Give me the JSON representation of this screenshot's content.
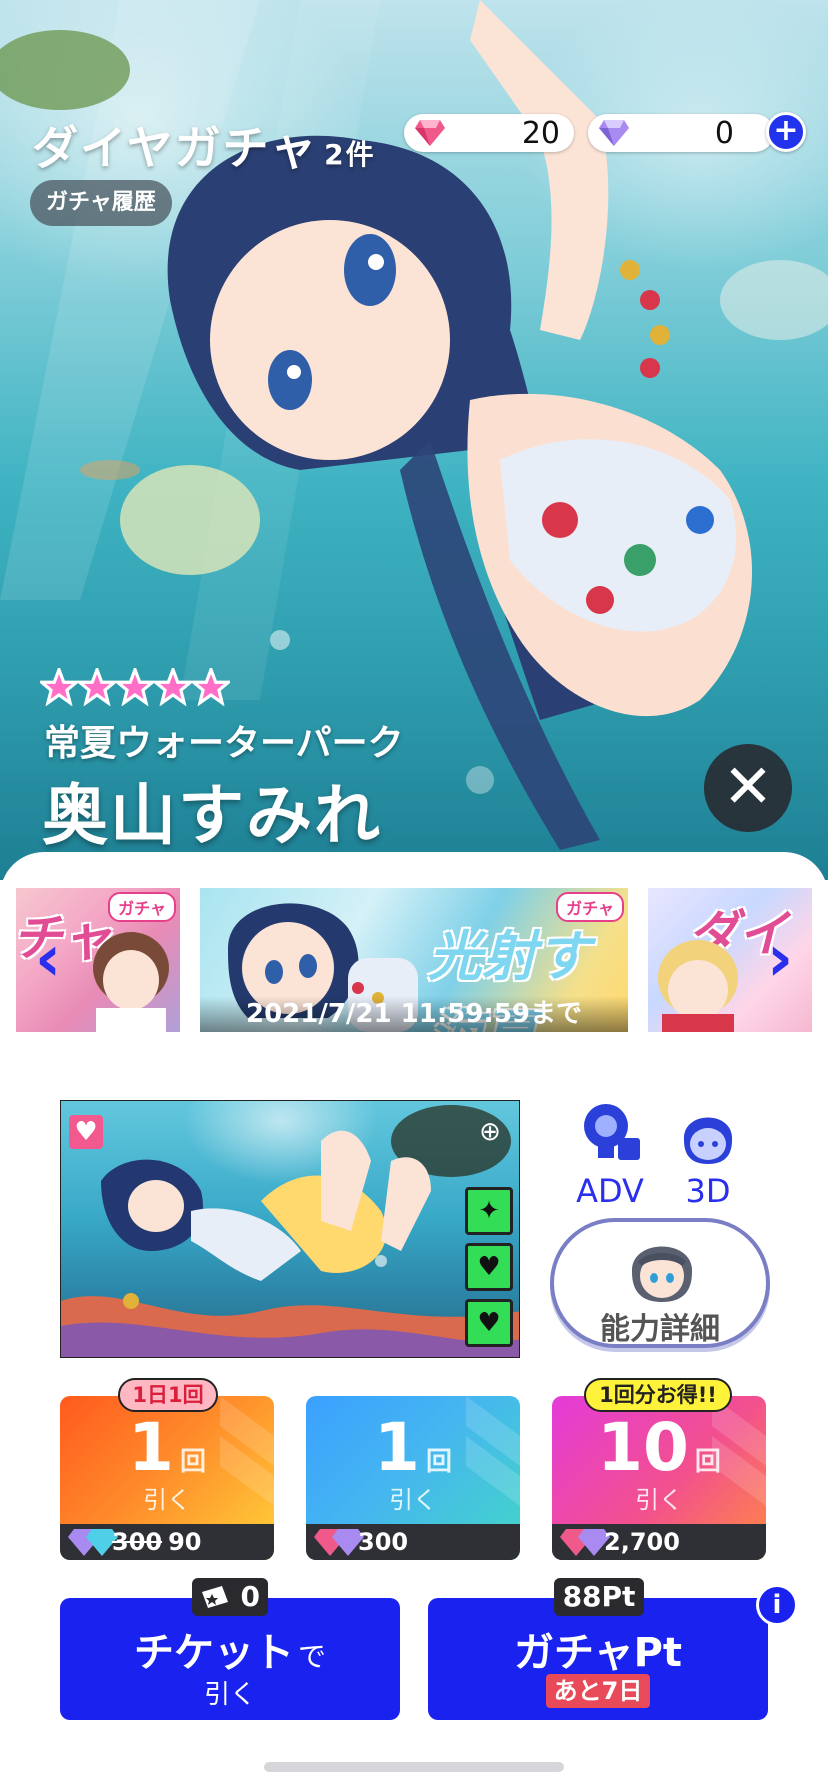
{
  "header": {
    "title": "ダイヤガチャ",
    "count": "2件",
    "history_label": "ガチャ履歴"
  },
  "currency": {
    "paid_diamonds": "20",
    "free_diamonds": "0",
    "add_label": "+"
  },
  "featured_card": {
    "rarity_stars": 5,
    "subtitle": "常夏ウォーターパーク",
    "name": "奥山すみれ",
    "close_label": "✕"
  },
  "banners": {
    "tag_label": "ガチャ",
    "left_art_text": "チャ",
    "main_art_text": "光射す海夏",
    "right_art_text": "ダイ",
    "main_deadline": "2021/7/21 11:59:59まで"
  },
  "tools": {
    "adv_label": "ADV",
    "threed_label": "3D",
    "ability_label": "能力詳細"
  },
  "draw_options": [
    {
      "ribbon": "1日1回",
      "count": "1",
      "unit": "回",
      "action": "引く",
      "old_price": "300",
      "price": "90"
    },
    {
      "ribbon": "",
      "count": "1",
      "unit": "回",
      "action": "引く",
      "old_price": "",
      "price": "300"
    },
    {
      "ribbon": "1回分お得!!",
      "count": "10",
      "unit": "回",
      "action": "引く",
      "old_price": "",
      "price": "2,700"
    }
  ],
  "ticket": {
    "count": "0",
    "main_label": "チケット",
    "suffix": "で",
    "sub_label": "引く"
  },
  "gacha_pt": {
    "points": "88Pt",
    "main_label": "ガチャPt",
    "remaining": "あと7日",
    "info_label": "i"
  },
  "colors": {
    "accent_blue": "#1a22f0",
    "pink": "#e6408a",
    "price_bar": "#2f2f36"
  }
}
